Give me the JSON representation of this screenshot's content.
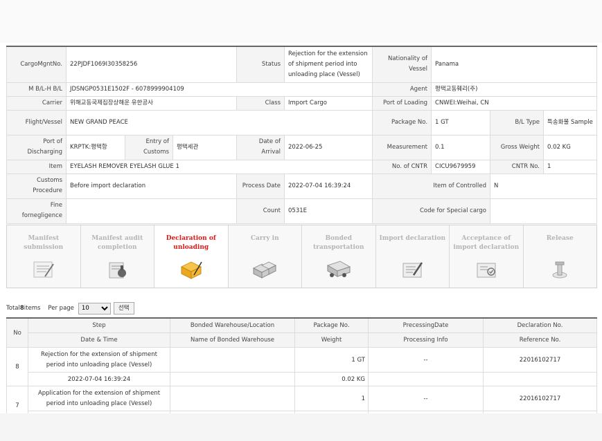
{
  "info": {
    "cargo_mgnt_no_label": "CargoMgntNo.",
    "cargo_mgnt_no": "22PJDF1069I30358256",
    "status_label": "Status",
    "status": "Rejection for the extension of shipment period into unloading place (Vessel)",
    "nationality_label": "Nationality of Vessel",
    "nationality": "Panama",
    "mbl_label": "M B/L-H B/L",
    "mbl": "JDSNGP0531E1502F - 6078999904109",
    "agent_label": "Agent",
    "agent": "평택교동훼리(주)",
    "carrier_label": "Carrier",
    "carrier": "위해교동국제집장상해운 유한공사",
    "class_label": "Class",
    "class": "Import Cargo",
    "port_loading_label": "Port of Loading",
    "port_loading": "CNWEI:Weihai, CN",
    "flight_label": "Flight/Vessel",
    "flight": "NEW GRAND PEACE",
    "package_label": "Package No.",
    "package": "1 GT",
    "bl_type_label": "B/L Type",
    "bl_type": "특송화물 Sample",
    "port_discharging_label": "Port of Discharging",
    "port_discharging": "KRPTK:평택항",
    "entry_customs_label": "Entry of Customs",
    "entry_customs": "평택세관",
    "date_arrival_label": "Date of Arrival",
    "date_arrival": "2022-06-25",
    "measurement_label": "Measurement",
    "measurement": "0.1",
    "gross_weight_label": "Gross Weight",
    "gross_weight": "0.02 KG",
    "item_label": "Item",
    "item": "EYELASH REMOVER EYELASH GLUE 1",
    "cntr_no_label": "No. of CNTR",
    "cntr_no": "CICU9679959",
    "cntr_count_label": "CNTR No.",
    "cntr_count": "1",
    "customs_procedure_label": "Customs Procedure",
    "customs_procedure": "Before import declaration",
    "process_date_label": "Process Date",
    "process_date": "2022-07-04 16:39:24",
    "controlled_label": "Item of Controlled",
    "controlled": "N",
    "fine_label": "Fine fornegligence",
    "fine": "",
    "count_label": "Count",
    "count": "0531E",
    "special_cargo_label": "Code for Special cargo",
    "special_cargo": ""
  },
  "steps": [
    {
      "label": "Manifest submission",
      "icon": "clipboard-icon"
    },
    {
      "label": "Manifest audit completion",
      "icon": "stamp-icon"
    },
    {
      "label": "Declaration of unloading",
      "icon": "folder-icon"
    },
    {
      "label": "Carry in",
      "icon": "boxes-icon"
    },
    {
      "label": "Bonded transportation",
      "icon": "truck-icon"
    },
    {
      "label": "Import declaration",
      "icon": "document-pen-icon"
    },
    {
      "label": "Acceptance of import declaration",
      "icon": "approval-icon"
    },
    {
      "label": "Release",
      "icon": "release-icon"
    }
  ],
  "active_step": 2,
  "active_color": "#e01818",
  "controls": {
    "total_prefix": "Total ",
    "total_count": "8",
    "total_suffix": " items",
    "per_page_label": "Per page",
    "per_page_value": "10",
    "select_button": "선택"
  },
  "history": {
    "headers_row1": {
      "no": "No",
      "step": "Step",
      "bonded": "Bonded Warehouse/Location",
      "package": "Package No.",
      "processing_date": "PrecessingDate",
      "declaration": "Declaration No."
    },
    "headers_row2": {
      "datetime": "Date & Time",
      "warehouse_name": "Name of Bonded Warehouse",
      "weight": "Weight",
      "processing_info": "Processing Info",
      "reference": "Reference No."
    },
    "rows": [
      {
        "no": "8",
        "step": "Rejection for the extension of shipment period into unloading place (Vessel)",
        "bonded": "",
        "package": "1 GT",
        "processing_date": "--",
        "declaration": "22016102717",
        "datetime": "2022-07-04 16:39:24",
        "warehouse_name": "",
        "weight": "0.02 KG",
        "processing_info": "",
        "reference": ""
      },
      {
        "no": "7",
        "step": "Application for the extension of shipment period into unloading place (Vessel)",
        "bonded": "",
        "package": "1",
        "processing_date": "--",
        "declaration": "22016102717",
        "datetime": "",
        "warehouse_name": "",
        "weight": "",
        "processing_info": "",
        "reference": ""
      }
    ]
  }
}
